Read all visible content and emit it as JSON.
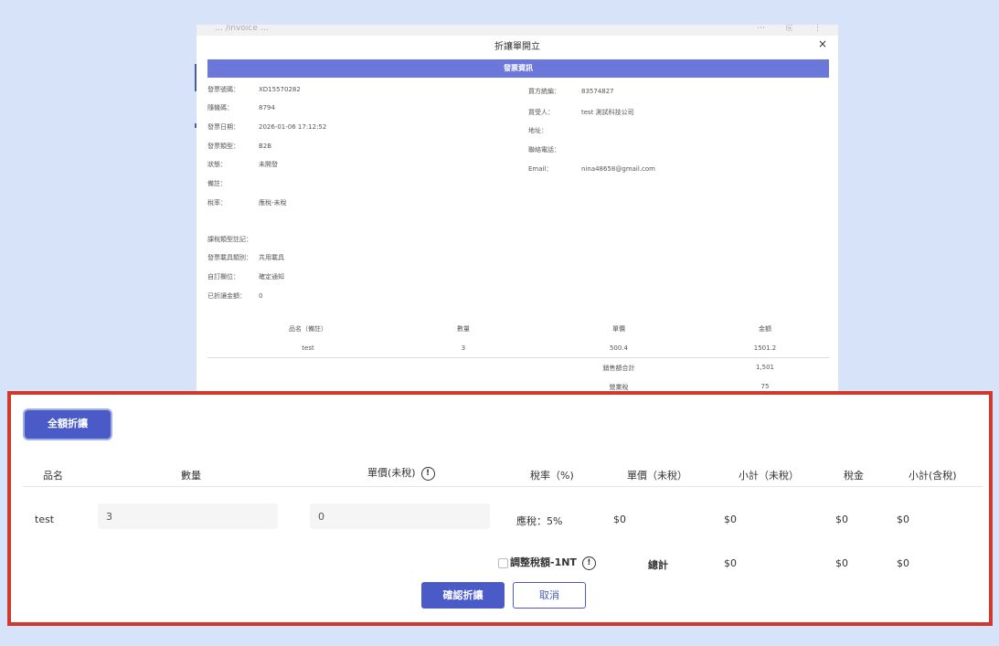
{
  "bg": {
    "url_text": "… /invoice …",
    "window_controls": "⋯  ⎘  ⋮",
    "modal_title": "折讓單開立",
    "close": "×",
    "section_title": "發票資訊",
    "left": [
      {
        "k": "發票號碼：",
        "v": "XD15570282"
      },
      {
        "k": "隨機碼：",
        "v": "8794"
      },
      {
        "k": "發票日期：",
        "v": "2026-01-06 17:12:52"
      },
      {
        "k": "發票類型：",
        "v": "B2B"
      },
      {
        "k": "狀態：",
        "v": "未開發"
      },
      {
        "k": "備註：",
        "v": ""
      },
      {
        "k": "稅率：",
        "v": "應稅-未稅"
      },
      {
        "k": "課稅類型註記：",
        "v": ""
      },
      {
        "k": "發票載具類別：",
        "v": "共用載具"
      },
      {
        "k": "自訂欄位：",
        "v": "確定通知"
      },
      {
        "k": "已折讓金額：",
        "v": "0"
      }
    ],
    "right": [
      {
        "k": "買方統編：",
        "v": "83574827"
      },
      {
        "k": "買受人：",
        "v": "test 測試科技公司"
      },
      {
        "k": "地址：",
        "v": ""
      },
      {
        "k": "聯絡電話：",
        "v": ""
      },
      {
        "k": "Email：",
        "v": "nina48658@gmail.com"
      }
    ],
    "items_headers": [
      "品名（備註）",
      "數量",
      "單價",
      "金額"
    ],
    "items_row": [
      "test",
      "3",
      "500.4",
      "1501.2"
    ],
    "sum1": {
      "label": "銷售額合計",
      "value": "1,501"
    },
    "sum2": {
      "label": "營業稅",
      "value": "75"
    }
  },
  "panel": {
    "full_discount_label": "全額折讓",
    "headers": {
      "name": "品名",
      "qty": "數量",
      "unit_price": "單價(未稅)",
      "tax_rate": "稅率（%)",
      "unit_price_notax": "單價（未稅）",
      "subtotal_notax": "小計（未稅）",
      "tax": "稅金",
      "subtotal_tax": "小計(含稅)"
    },
    "row": {
      "name": "test",
      "qty": "3",
      "unit_price": "0",
      "tax_rate": "應稅：5%",
      "unit_price_notax": "$0",
      "subtotal_notax": "$0",
      "tax": "$0",
      "subtotal_tax": "$0"
    },
    "adjust_label": "調整稅額-1NT",
    "total_label": "總計",
    "total_subtotal": "$0",
    "total_tax": "$0",
    "total_with_tax": "$0",
    "confirm_label": "確認折讓",
    "cancel_label": "取消",
    "info_glyph": "!"
  }
}
